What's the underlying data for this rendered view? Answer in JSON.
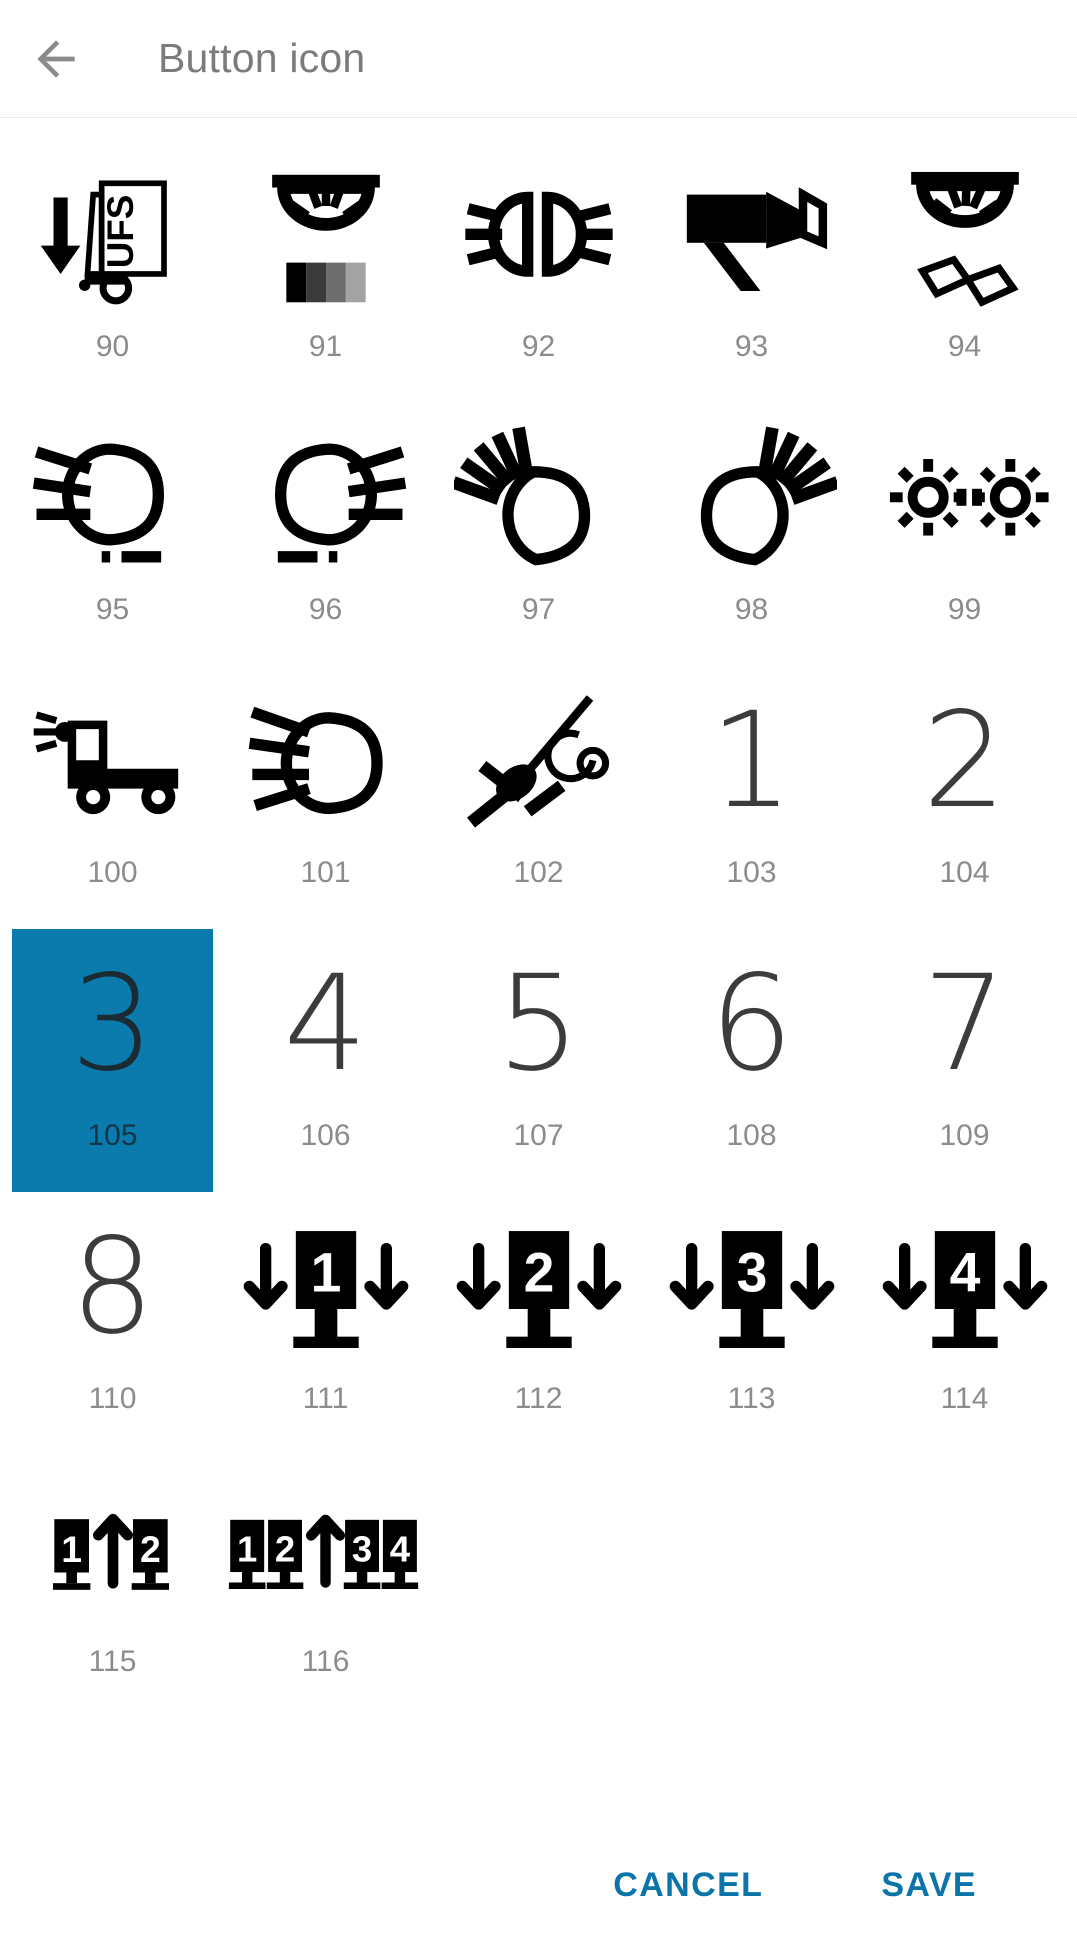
{
  "header": {
    "title": "Button icon",
    "back_icon": "arrow-back-icon"
  },
  "grid": {
    "selected_index": 15,
    "selected_color": "#0b7bad",
    "label_color": "#8c8c8c",
    "items": [
      {
        "num": "90",
        "icon": "forklift-ufs-down-arrow-icon",
        "kind": "pictogram"
      },
      {
        "num": "91",
        "icon": "ceiling-light-gradient-icon",
        "kind": "pictogram"
      },
      {
        "num": "92",
        "icon": "double-headlight-beams-icon",
        "kind": "pictogram"
      },
      {
        "num": "93",
        "icon": "spotlight-projector-icon",
        "kind": "pictogram"
      },
      {
        "num": "94",
        "icon": "reading-light-book-icon",
        "kind": "pictogram"
      },
      {
        "num": "95",
        "icon": "low-beam-left-icon",
        "kind": "pictogram"
      },
      {
        "num": "96",
        "icon": "low-beam-right-icon",
        "kind": "pictogram"
      },
      {
        "num": "97",
        "icon": "high-beam-left-icon",
        "kind": "pictogram"
      },
      {
        "num": "98",
        "icon": "high-beam-right-icon",
        "kind": "pictogram"
      },
      {
        "num": "99",
        "icon": "double-sun-daytime-lights-icon",
        "kind": "pictogram"
      },
      {
        "num": "100",
        "icon": "truck-headlight-icon",
        "kind": "pictogram"
      },
      {
        "num": "101",
        "icon": "headlight-beam-icon",
        "kind": "pictogram"
      },
      {
        "num": "102",
        "icon": "work-lamp-diagonal-icon",
        "kind": "pictogram"
      },
      {
        "num": "103",
        "icon": "digit-1-icon",
        "kind": "digit",
        "digit": "1"
      },
      {
        "num": "104",
        "icon": "digit-2-icon",
        "kind": "digit",
        "digit": "2"
      },
      {
        "num": "105",
        "icon": "digit-3-icon",
        "kind": "digit",
        "digit": "3"
      },
      {
        "num": "106",
        "icon": "digit-4-icon",
        "kind": "digit",
        "digit": "4"
      },
      {
        "num": "107",
        "icon": "digit-5-icon",
        "kind": "digit",
        "digit": "5"
      },
      {
        "num": "108",
        "icon": "digit-6-icon",
        "kind": "digit",
        "digit": "6"
      },
      {
        "num": "109",
        "icon": "digit-7-icon",
        "kind": "digit",
        "digit": "7"
      },
      {
        "num": "110",
        "icon": "digit-8-icon",
        "kind": "digit",
        "digit": "8"
      },
      {
        "num": "111",
        "icon": "axle-lift-1-down-icon",
        "kind": "axle-down",
        "axle_label": "1"
      },
      {
        "num": "112",
        "icon": "axle-lift-2-down-icon",
        "kind": "axle-down",
        "axle_label": "2"
      },
      {
        "num": "113",
        "icon": "axle-lift-3-down-icon",
        "kind": "axle-down",
        "axle_label": "3"
      },
      {
        "num": "114",
        "icon": "axle-lift-4-down-icon",
        "kind": "axle-down",
        "axle_label": "4"
      },
      {
        "num": "115",
        "icon": "axle-transfer-1-up-2-icon",
        "kind": "axle-transfer",
        "left_labels": [
          "1"
        ],
        "right_labels": [
          "2"
        ]
      },
      {
        "num": "116",
        "icon": "axle-transfer-12-up-34-icon",
        "kind": "axle-transfer",
        "left_labels": [
          "1",
          "2"
        ],
        "right_labels": [
          "3",
          "4"
        ]
      }
    ]
  },
  "actions": {
    "cancel_label": "CANCEL",
    "save_label": "SAVE",
    "accent_color": "#0b74a8"
  }
}
